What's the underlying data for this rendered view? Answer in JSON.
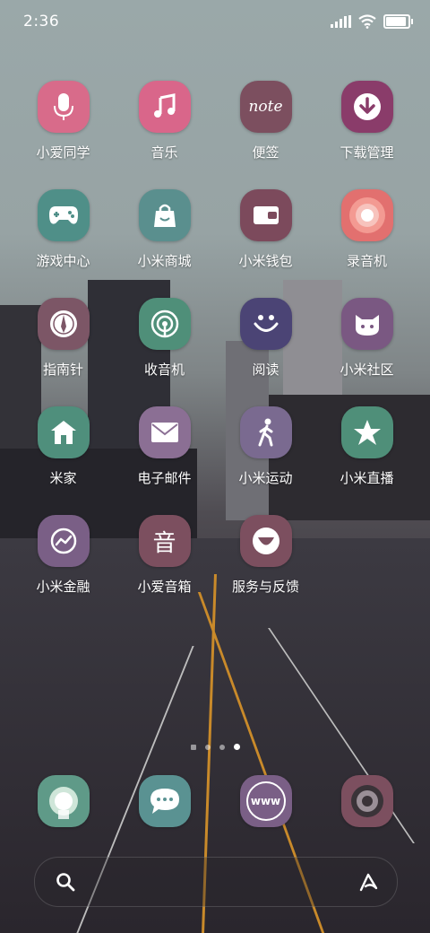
{
  "status": {
    "time": "2:36"
  },
  "apps": [
    {
      "id": "xiaoai",
      "label": "小爱同学",
      "icon": "microphone-icon",
      "color": "#d86b8a"
    },
    {
      "id": "music",
      "label": "音乐",
      "icon": "music-note-icon",
      "color": "#d9668a"
    },
    {
      "id": "notes",
      "label": "便签",
      "icon": "note-icon",
      "color": "#7c4f5f",
      "glyph": "note"
    },
    {
      "id": "downloads",
      "label": "下载管理",
      "icon": "download-icon",
      "color": "#8a3c6a"
    },
    {
      "id": "games",
      "label": "游戏中心",
      "icon": "gamepad-icon",
      "color": "#4f8f88"
    },
    {
      "id": "mall",
      "label": "小米商城",
      "icon": "shopping-bag-icon",
      "color": "#5a8f8e"
    },
    {
      "id": "wallet",
      "label": "小米钱包",
      "icon": "wallet-icon",
      "color": "#7c4a5c"
    },
    {
      "id": "recorder",
      "label": "录音机",
      "icon": "record-icon",
      "color": "#e2706f"
    },
    {
      "id": "compass",
      "label": "指南针",
      "icon": "compass-icon",
      "color": "#7c5666"
    },
    {
      "id": "radio",
      "label": "收音机",
      "icon": "radio-icon",
      "color": "#4f8f79"
    },
    {
      "id": "reader",
      "label": "阅读",
      "icon": "smile-icon",
      "color": "#4b4475"
    },
    {
      "id": "community",
      "label": "小米社区",
      "icon": "mi-bunny-icon",
      "color": "#7a5882"
    },
    {
      "id": "home",
      "label": "米家",
      "icon": "home-icon",
      "color": "#4f8f7c"
    },
    {
      "id": "mail",
      "label": "电子邮件",
      "icon": "mail-icon",
      "color": "#8b6f94"
    },
    {
      "id": "sports",
      "label": "小米运动",
      "icon": "walking-person-icon",
      "color": "#7a6a90"
    },
    {
      "id": "live",
      "label": "小米直播",
      "icon": "star-icon",
      "color": "#4f8f79"
    },
    {
      "id": "finance",
      "label": "小米金融",
      "icon": "finance-icon",
      "color": "#7a5f86"
    },
    {
      "id": "speaker",
      "label": "小爱音箱",
      "icon": "speaker-icon",
      "color": "#7c4f5f",
      "glyph": "音"
    },
    {
      "id": "feedback",
      "label": "服务与反馈",
      "icon": "feedback-icon",
      "color": "#7c4f5f"
    }
  ],
  "dock": [
    {
      "id": "phone",
      "icon": "phone-icon",
      "color": "#5f9a88"
    },
    {
      "id": "messages",
      "icon": "message-icon",
      "color": "#5a9292"
    },
    {
      "id": "browser",
      "icon": "browser-www-icon",
      "color": "#7a5f86",
      "glyph": "www"
    },
    {
      "id": "camera",
      "icon": "camera-icon",
      "color": "#7c4f5f"
    }
  ],
  "page_indicator": {
    "pages": 3,
    "current": 3
  }
}
